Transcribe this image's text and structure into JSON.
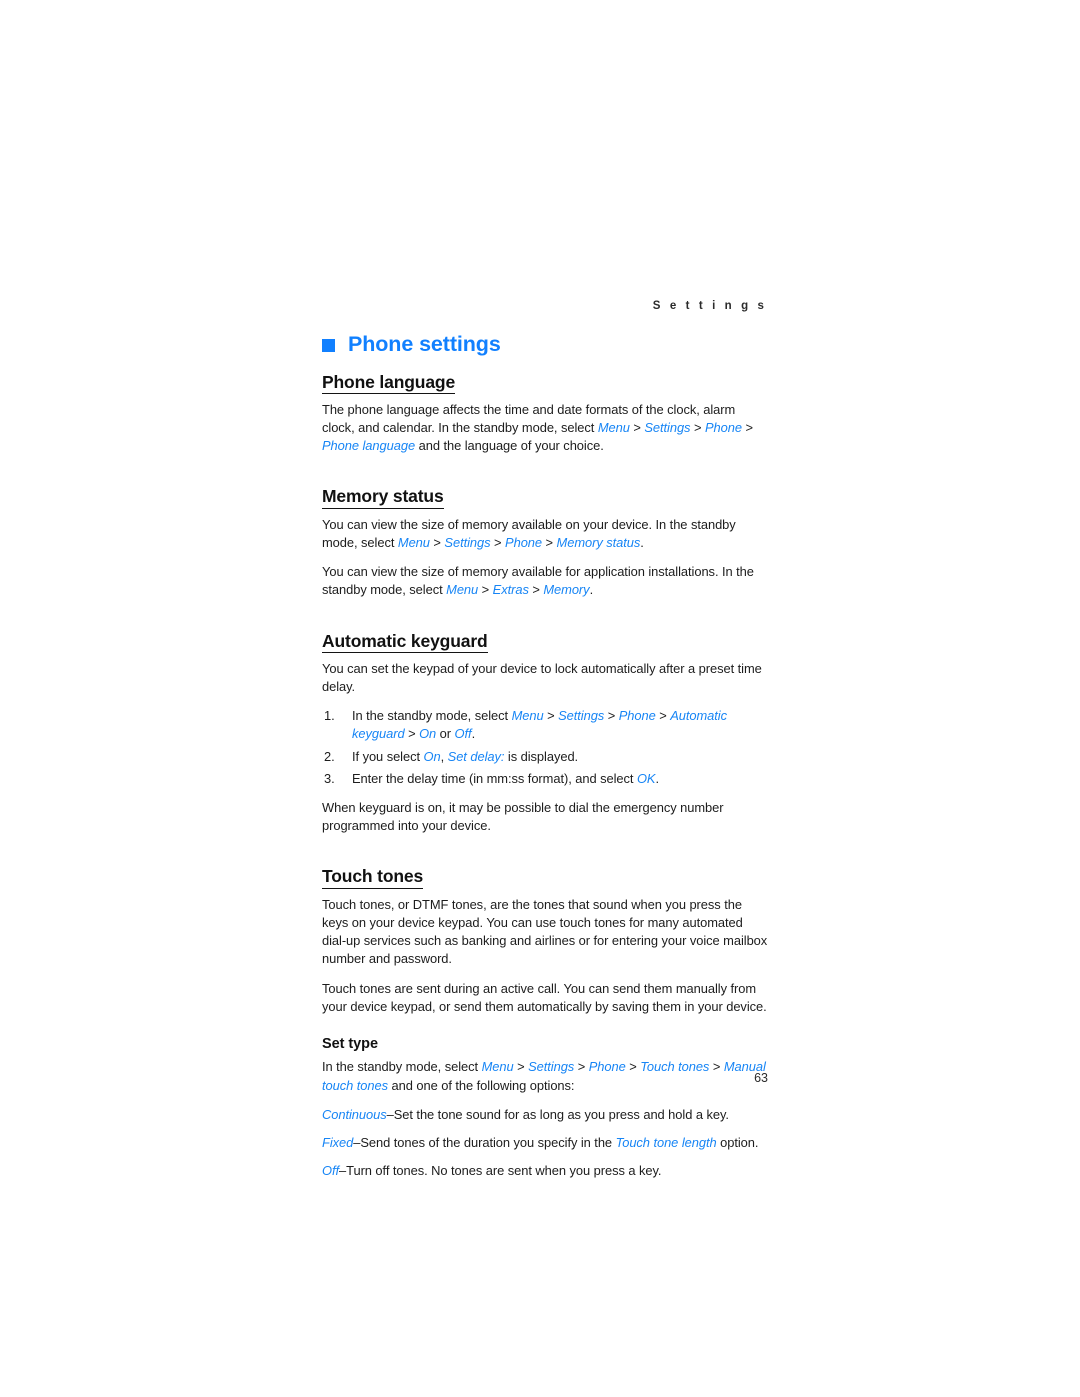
{
  "running_header": "S e t t i n g s",
  "accent_color": "#1180ff",
  "link_color": "#1785f5",
  "chapter": {
    "bullet": "square-bullet",
    "title": "Phone settings"
  },
  "sections": [
    {
      "heading": "Phone language",
      "paragraphs": [
        {
          "parts": [
            {
              "t": "The phone language affects the time and date formats of the clock, alarm clock, and calendar. In the standby mode, select "
            },
            {
              "ui": "Menu"
            },
            {
              "t": " > "
            },
            {
              "ui": "Settings"
            },
            {
              "t": " > "
            },
            {
              "ui": "Phone"
            },
            {
              "t": " > "
            },
            {
              "ui": "Phone language"
            },
            {
              "t": " and the language of your choice."
            }
          ]
        }
      ]
    },
    {
      "heading": "Memory status",
      "paragraphs": [
        {
          "parts": [
            {
              "t": "You can view the size of memory available on your device. In the standby mode, select "
            },
            {
              "ui": "Menu"
            },
            {
              "t": " > "
            },
            {
              "ui": "Settings"
            },
            {
              "t": " > "
            },
            {
              "ui": "Phone"
            },
            {
              "t": " > "
            },
            {
              "ui": "Memory status"
            },
            {
              "t": "."
            }
          ]
        },
        {
          "parts": [
            {
              "t": "You can view the size of memory available for application installations. In the standby mode, select "
            },
            {
              "ui": "Menu"
            },
            {
              "t": " > "
            },
            {
              "ui": "Extras"
            },
            {
              "t": " > "
            },
            {
              "ui": "Memory"
            },
            {
              "t": "."
            }
          ]
        }
      ]
    },
    {
      "heading": "Automatic keyguard",
      "paragraphs": [
        {
          "parts": [
            {
              "t": "You can set the keypad of your device to lock automatically after a preset time delay."
            }
          ]
        }
      ],
      "steps": [
        {
          "num": "1.",
          "parts": [
            {
              "t": "In the standby mode, select "
            },
            {
              "ui": "Menu"
            },
            {
              "t": " > "
            },
            {
              "ui": "Settings"
            },
            {
              "t": " > "
            },
            {
              "ui": "Phone"
            },
            {
              "t": " > "
            },
            {
              "ui": "Automatic keyguard"
            },
            {
              "t": " > "
            },
            {
              "ui": "On"
            },
            {
              "t": " or "
            },
            {
              "ui": "Off"
            },
            {
              "t": "."
            }
          ]
        },
        {
          "num": "2.",
          "parts": [
            {
              "t": "If you select "
            },
            {
              "ui": "On"
            },
            {
              "t": ", "
            },
            {
              "ui": "Set delay:"
            },
            {
              "t": " is displayed."
            }
          ]
        },
        {
          "num": "3.",
          "parts": [
            {
              "t": "Enter the delay time (in mm:ss format), and select "
            },
            {
              "ui": "OK"
            },
            {
              "t": "."
            }
          ]
        }
      ],
      "after_steps": [
        {
          "parts": [
            {
              "t": "When keyguard is on, it may be possible to dial the emergency number programmed into your device."
            }
          ]
        }
      ]
    },
    {
      "heading": "Touch tones",
      "paragraphs": [
        {
          "parts": [
            {
              "t": "Touch tones, or DTMF tones, are the tones that sound when you press the keys on your device keypad. You can use touch tones for many automated dial-up services such as banking and airlines or for entering your voice mailbox number and password."
            }
          ]
        },
        {
          "parts": [
            {
              "t": "Touch tones are sent during an active call. You can send them manually from your device keypad, or send them automatically by saving them in your device."
            }
          ]
        }
      ],
      "subsection": {
        "subheading": "Set type",
        "paragraphs": [
          {
            "parts": [
              {
                "t": "In the standby mode, select "
              },
              {
                "ui": "Menu"
              },
              {
                "t": " > "
              },
              {
                "ui": "Settings"
              },
              {
                "t": " > "
              },
              {
                "ui": "Phone"
              },
              {
                "t": " > "
              },
              {
                "ui": "Touch tones"
              },
              {
                "t": " > "
              },
              {
                "ui": "Manual touch tones"
              },
              {
                "t": " and one of the following options:"
              }
            ]
          }
        ],
        "options": [
          {
            "parts": [
              {
                "ui": "Continuous"
              },
              {
                "t": "–Set the tone sound for as long as you press and hold a key."
              }
            ]
          },
          {
            "parts": [
              {
                "ui": "Fixed"
              },
              {
                "t": "–Send tones of the duration you specify in the "
              },
              {
                "ui": "Touch tone length"
              },
              {
                "t": " option."
              }
            ]
          },
          {
            "parts": [
              {
                "ui": "Off"
              },
              {
                "t": "–Turn off tones. No tones are sent when you press a key."
              }
            ]
          }
        ]
      }
    }
  ],
  "page_number": "63"
}
